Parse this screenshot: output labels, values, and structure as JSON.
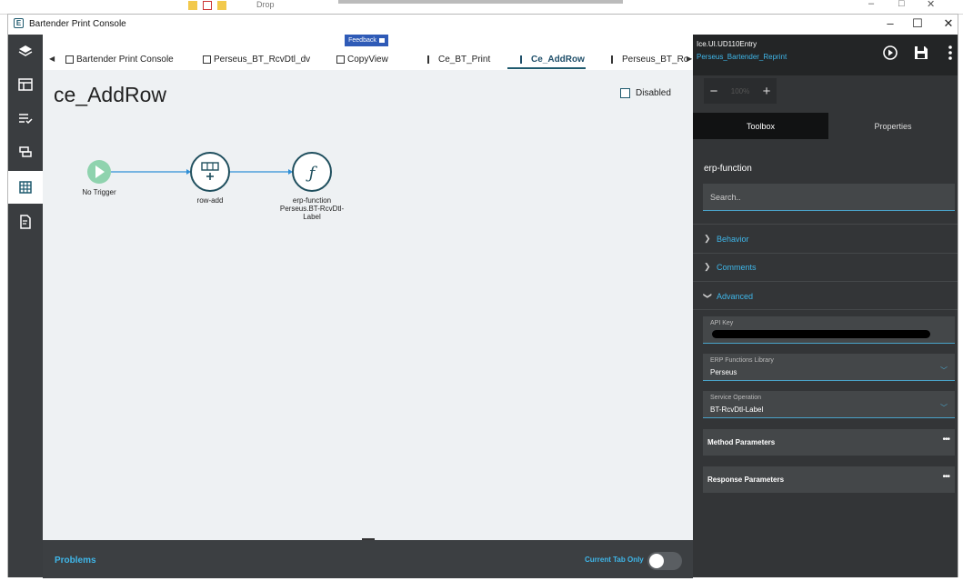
{
  "background_window": {
    "drop_label": "Drop"
  },
  "window": {
    "title": "Bartender Print Console"
  },
  "feedback": {
    "label": "Feedback"
  },
  "tabs": [
    {
      "label": "Bartender Print Console"
    },
    {
      "label": "Perseus_BT_RcvDtl_dv"
    },
    {
      "label": "CopyView"
    },
    {
      "label": "Ce_BT_Print"
    },
    {
      "label": "Ce_AddRow"
    },
    {
      "label": "Perseus_BT_Rc"
    }
  ],
  "canvas": {
    "title": "ce_AddRow",
    "disabled_label": "Disabled",
    "nodes": [
      {
        "label": "No Trigger"
      },
      {
        "label": "row-add"
      },
      {
        "label": "erp-function",
        "sublabel_1": "Perseus.BT-RcvDtl-",
        "sublabel_2": "Label"
      }
    ]
  },
  "problems": {
    "label": "Problems",
    "current_tab_label": "Current Tab Only",
    "current_tab_only": false
  },
  "right_panel": {
    "header_line1": "Ice.UI.UD110Entry",
    "header_line2": "Perseus_Bartender_Reprint",
    "zoom": {
      "minus": "−",
      "value": "100%",
      "plus": "+"
    },
    "tabs": {
      "toolbox": "Toolbox",
      "properties": "Properties"
    },
    "section_title": "erp-function",
    "search_placeholder": "Search..",
    "groups": {
      "behavior": "Behavior",
      "comments": "Comments",
      "advanced": "Advanced"
    },
    "fields": {
      "api_key_label": "API Key",
      "erp_lib_label": "ERP Functions Library",
      "erp_lib_value": "Perseus",
      "service_op_label": "Service Operation",
      "service_op_value": "BT-RcvDtl-Label"
    },
    "params": {
      "method": "Method Parameters",
      "response": "Response Parameters",
      "menu": "•••"
    }
  },
  "colors": {
    "accent": "#3fb7ea",
    "node_stroke": "#1f4f5e",
    "trigger": "#8fd3ae"
  }
}
